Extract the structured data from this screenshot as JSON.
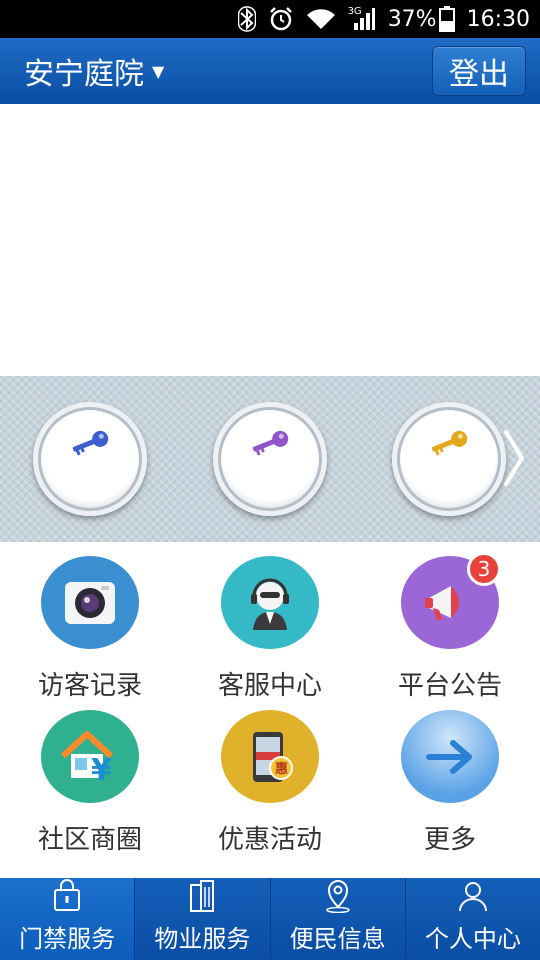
{
  "status_bar": {
    "battery": "37%",
    "time": "16:30",
    "network": "3G",
    "icons": [
      "bluetooth-icon",
      "alarm-icon",
      "wifi-icon",
      "signal-icon",
      "battery-icon"
    ]
  },
  "header": {
    "community": "安宁庭院",
    "logout_label": "登出",
    "color": "#0d55b0"
  },
  "key_strip": {
    "keys": [
      {
        "icon": "key-blue-icon",
        "color": "#3b5fcf"
      },
      {
        "icon": "key-purple-icon",
        "color": "#8f55c9"
      },
      {
        "icon": "key-gold-icon",
        "color": "#e3a81c"
      }
    ],
    "next_icon": "chevron-right-icon"
  },
  "grid": {
    "items": [
      {
        "label": "访客记录",
        "icon": "camera-icon",
        "color": "#3a8fd0"
      },
      {
        "label": "客服中心",
        "icon": "headset-agent-icon",
        "color": "#35b9c6"
      },
      {
        "label": "平台公告",
        "icon": "megaphone-icon",
        "color": "#9b66d6",
        "badge": "3"
      },
      {
        "label": "社区商圈",
        "icon": "house-currency-icon",
        "color": "#2fb08e"
      },
      {
        "label": "优惠活动",
        "icon": "phone-discount-icon",
        "color": "#e0b22b"
      },
      {
        "label": "更多",
        "icon": "arrow-right-icon",
        "color": "#5aa2e6"
      }
    ]
  },
  "tabs": [
    {
      "label": "门禁服务",
      "icon": "lock-bag-icon",
      "active": true
    },
    {
      "label": "物业服务",
      "icon": "building-icon",
      "active": false
    },
    {
      "label": "便民信息",
      "icon": "location-pin-icon",
      "active": false
    },
    {
      "label": "个人中心",
      "icon": "user-icon",
      "active": false
    }
  ]
}
